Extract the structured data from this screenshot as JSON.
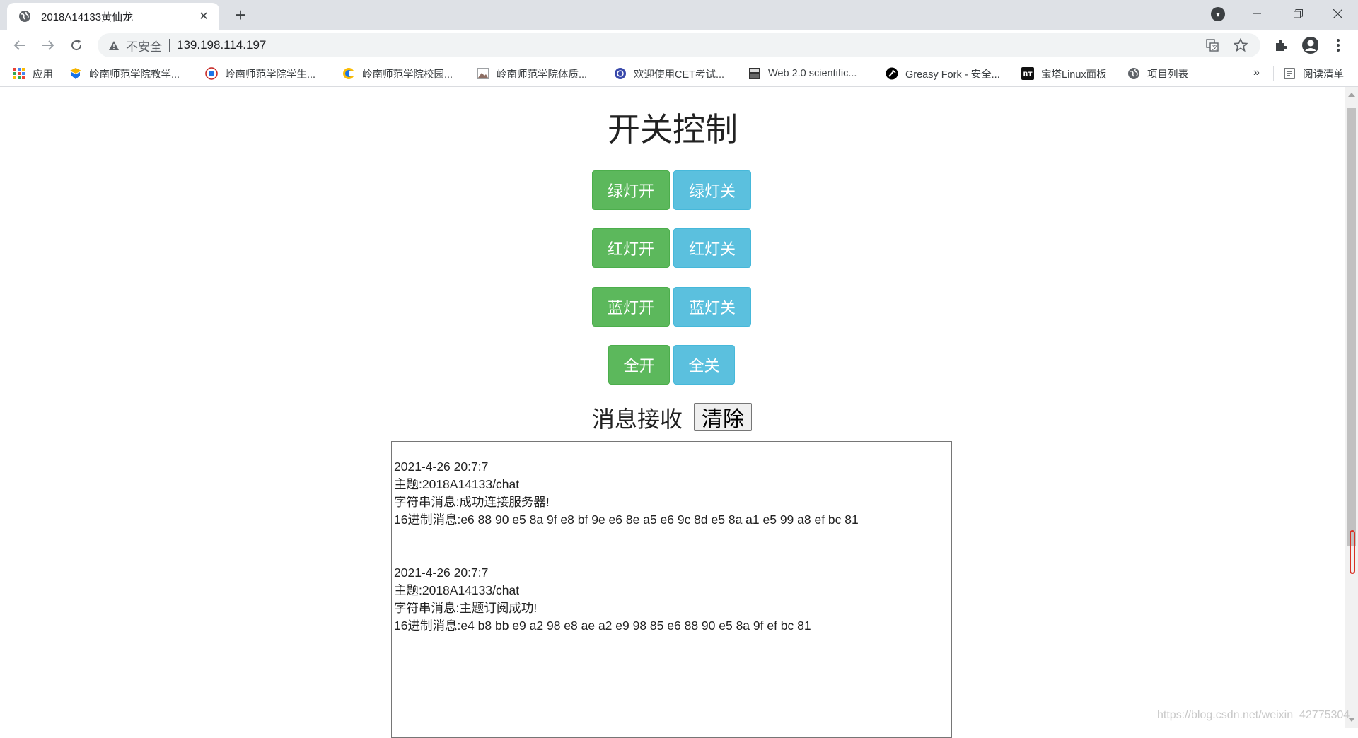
{
  "browser": {
    "tab_title": "2018A14133黄仙龙",
    "new_tab_symbol": "+",
    "close_symbol": "✕",
    "insecure_label": "不安全",
    "url": "139.198.114.197"
  },
  "bookmarks": {
    "apps_label": "应用",
    "items": [
      "岭南师范学院教学...",
      "岭南师范学院学生...",
      "岭南师范学院校园...",
      "岭南师范学院体质...",
      "欢迎使用CET考试...",
      "Web 2.0 scientific...",
      "Greasy Fork - 安全...",
      "宝塔Linux面板",
      "项目列表"
    ],
    "more_symbol": "»",
    "reading_list_label": "阅读清单"
  },
  "page": {
    "title": "开关控制",
    "buttons": {
      "green_on": "绿灯开",
      "green_off": "绿灯关",
      "red_on": "红灯开",
      "red_off": "红灯关",
      "blue_on": "蓝灯开",
      "blue_off": "蓝灯关",
      "all_on": "全开",
      "all_off": "全关"
    },
    "message_title": "消息接收",
    "clear_label": "清除",
    "messages": [
      {
        "time": "2021-4-26 20:7:7",
        "topic": "主题:2018A14133/chat",
        "text": "字符串消息:成功连接服务器!",
        "hex": "16进制消息:e6 88 90 e5 8a 9f e8 bf 9e e6 8e a5 e6 9c 8d e5 8a a1 e5 99 a8 ef bc 81"
      },
      {
        "time": "2021-4-26 20:7:7",
        "topic": "主题:2018A14133/chat",
        "text": "字符串消息:主题订阅成功!",
        "hex": "16进制消息:e4 b8 bb e9 a2 98 e8 ae a2 e9 98 85 e6 88 90 e5 8a 9f ef bc 81"
      }
    ],
    "watermark": "https://blog.csdn.net/weixin_42775304"
  },
  "colors": {
    "on_button": "#5cb85c",
    "off_button": "#5bc0de"
  }
}
